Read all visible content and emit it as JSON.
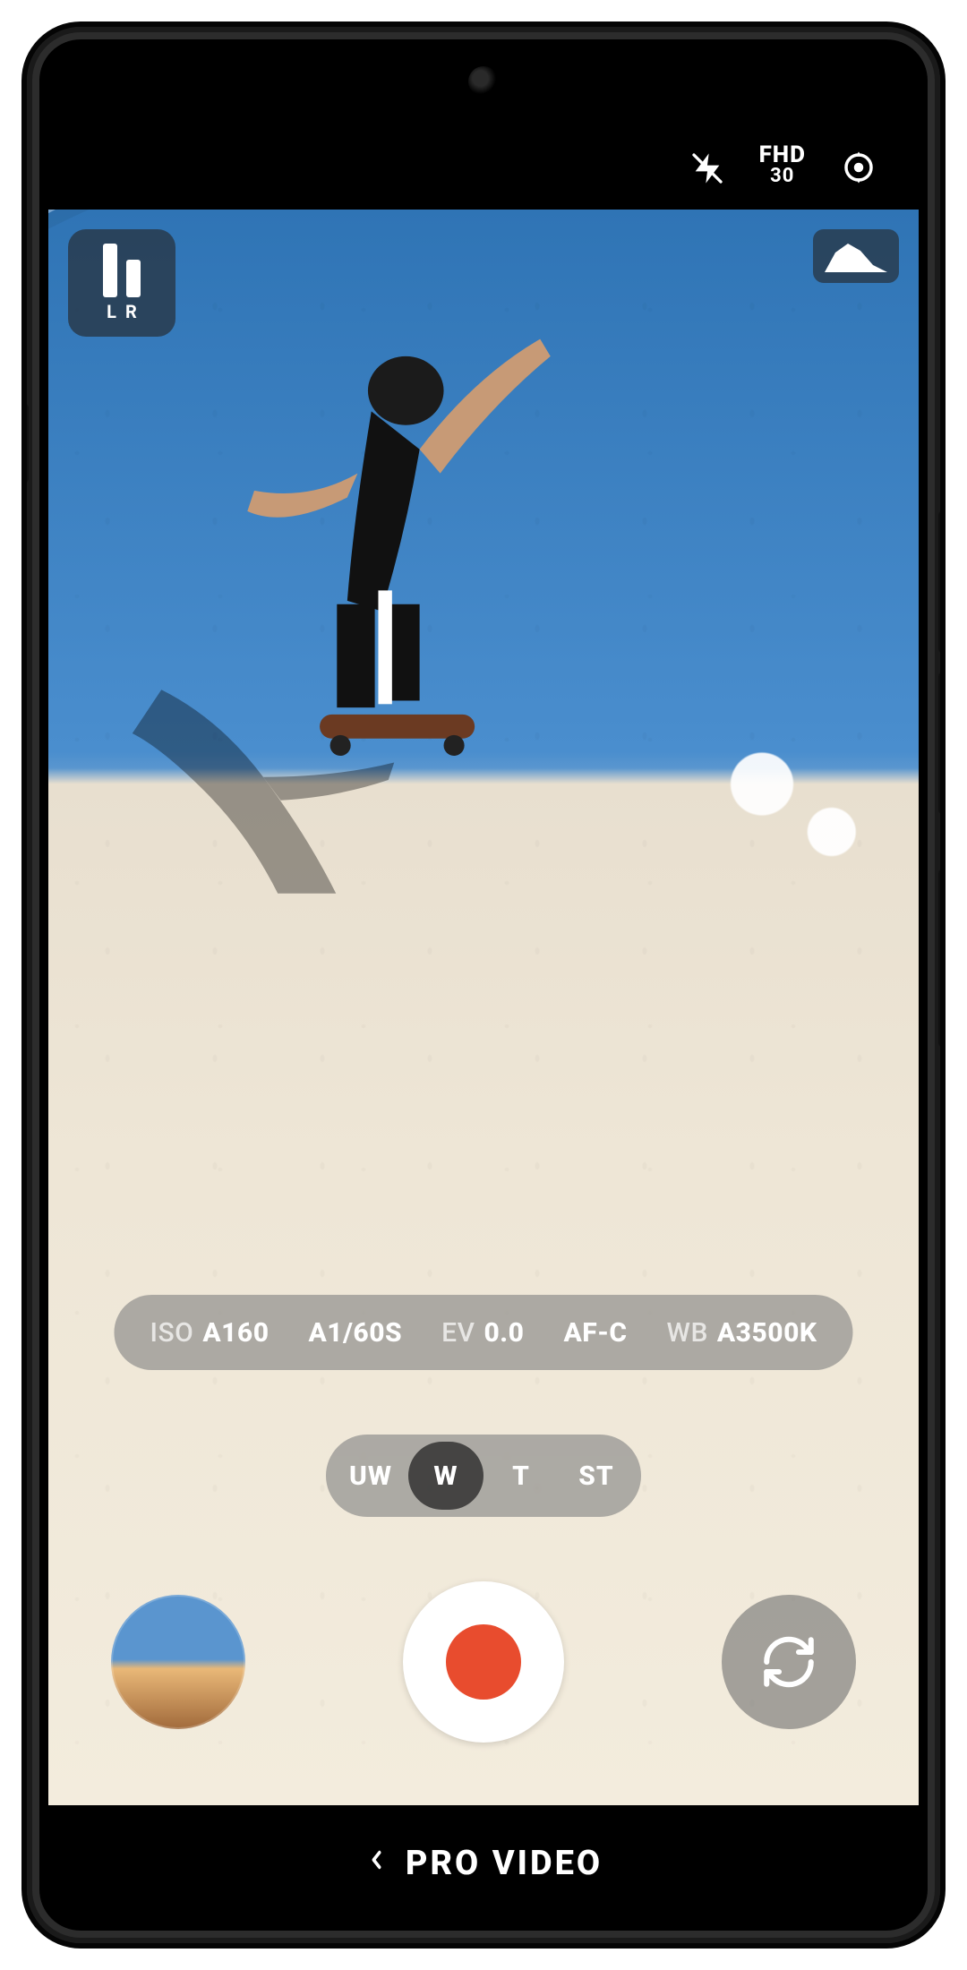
{
  "topbar": {
    "flash": "off",
    "resolution_label": "FHD",
    "resolution_fps": "30"
  },
  "overlays": {
    "audio_levels": {
      "left_label": "L",
      "right_label": "R"
    },
    "histogram": true
  },
  "settings": {
    "iso": {
      "label": "ISO",
      "value": "A160"
    },
    "speed": {
      "label": "",
      "value": "A1/60S"
    },
    "ev": {
      "label": "EV",
      "value": "0.0"
    },
    "af": {
      "label": "",
      "value": "AF-C"
    },
    "wb": {
      "label": "WB",
      "value": "A3500K"
    }
  },
  "lenses": {
    "options": [
      "UW",
      "W",
      "T",
      "ST"
    ],
    "active": "W"
  },
  "bottom": {
    "mode_label": "PRO VIDEO"
  }
}
